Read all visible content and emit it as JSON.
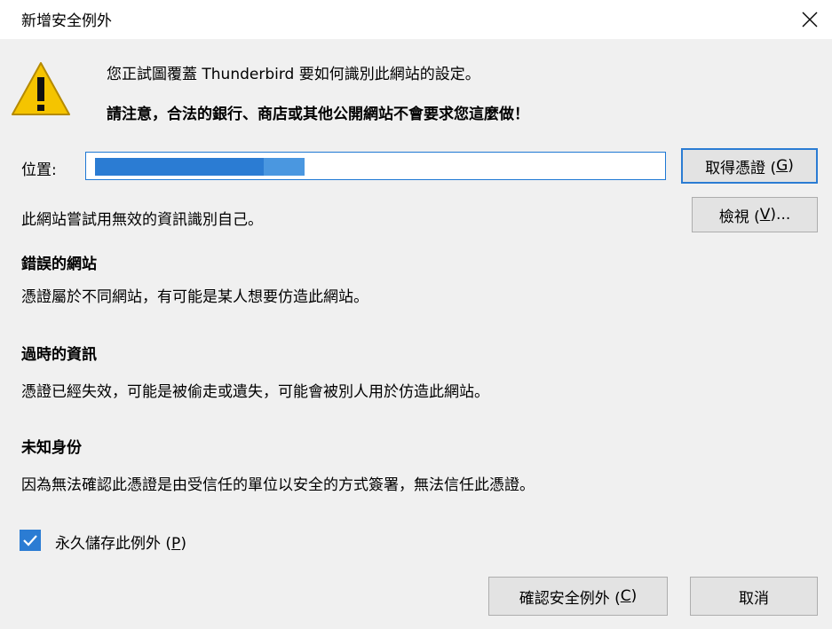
{
  "window": {
    "title": "新增安全例外"
  },
  "warning": {
    "line1": "您正試圖覆蓋 Thunderbird 要如何識別此網站的設定。",
    "line2": "請注意，合法的銀行、商店或其他公開網站不會要求您這麼做！"
  },
  "location": {
    "label": "位置:",
    "value": ""
  },
  "buttons": {
    "get_cert": {
      "text": "取得憑證 (",
      "key": "G",
      "tail": ")"
    },
    "view": {
      "text": "檢視 (",
      "key": "V",
      "tail": ")..."
    },
    "confirm": {
      "text": "確認安全例外 (",
      "key": "C",
      "tail": ")"
    },
    "cancel": "取消"
  },
  "status_text": "此網站嘗試用無效的資訊識別自己。",
  "issues": [
    {
      "heading": "錯誤的網站",
      "detail": "憑證屬於不同網站，有可能是某人想要仿造此網站。"
    },
    {
      "heading": "過時的資訊",
      "detail": "憑證已經失效，可能是被偷走或遺失，可能會被別人用於仿造此網站。"
    },
    {
      "heading": "未知身份",
      "detail": "因為無法確認此憑證是由受信任的單位以安全的方式簽署，無法信任此憑證。"
    }
  ],
  "permanent": {
    "text": "永久儲存此例外 (",
    "key": "P",
    "tail": ")",
    "checked": true
  },
  "colors": {
    "accent": "#2b7cd3",
    "warning": "#f5c400"
  }
}
